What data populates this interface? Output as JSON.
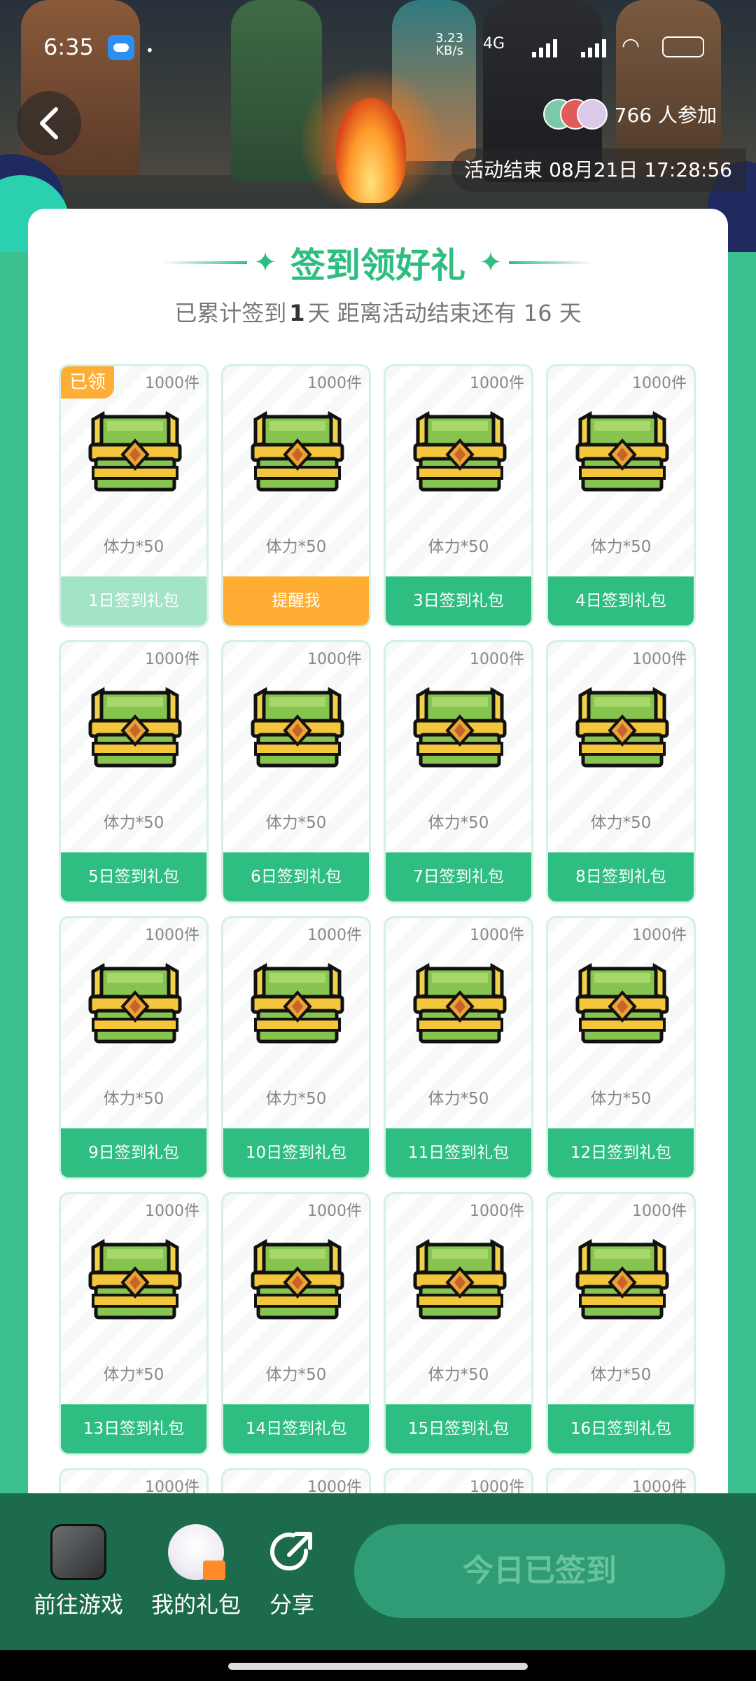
{
  "status_bar": {
    "time": "6:35",
    "rate": "3.23\nKB/s",
    "network": "4G"
  },
  "header": {
    "participants_text": "766 人参加",
    "end_time_label": "活动结束 08月21日 17:28:56"
  },
  "panel": {
    "title": "签到领好礼",
    "subtitle_prefix": "已累计签到",
    "subtitle_days": "1",
    "subtitle_middle": "天  距离活动结束还有 16 天"
  },
  "cards": [
    {
      "qty": "1000件",
      "reward": "体力*50",
      "button": "1日签到礼包",
      "state": "claimed",
      "badge": "已领"
    },
    {
      "qty": "1000件",
      "reward": "体力*50",
      "button": "提醒我",
      "state": "remind"
    },
    {
      "qty": "1000件",
      "reward": "体力*50",
      "button": "3日签到礼包",
      "state": "normal"
    },
    {
      "qty": "1000件",
      "reward": "体力*50",
      "button": "4日签到礼包",
      "state": "normal"
    },
    {
      "qty": "1000件",
      "reward": "体力*50",
      "button": "5日签到礼包",
      "state": "normal"
    },
    {
      "qty": "1000件",
      "reward": "体力*50",
      "button": "6日签到礼包",
      "state": "normal"
    },
    {
      "qty": "1000件",
      "reward": "体力*50",
      "button": "7日签到礼包",
      "state": "normal"
    },
    {
      "qty": "1000件",
      "reward": "体力*50",
      "button": "8日签到礼包",
      "state": "normal"
    },
    {
      "qty": "1000件",
      "reward": "体力*50",
      "button": "9日签到礼包",
      "state": "normal"
    },
    {
      "qty": "1000件",
      "reward": "体力*50",
      "button": "10日签到礼包",
      "state": "normal"
    },
    {
      "qty": "1000件",
      "reward": "体力*50",
      "button": "11日签到礼包",
      "state": "normal"
    },
    {
      "qty": "1000件",
      "reward": "体力*50",
      "button": "12日签到礼包",
      "state": "normal"
    },
    {
      "qty": "1000件",
      "reward": "体力*50",
      "button": "13日签到礼包",
      "state": "normal"
    },
    {
      "qty": "1000件",
      "reward": "体力*50",
      "button": "14日签到礼包",
      "state": "normal"
    },
    {
      "qty": "1000件",
      "reward": "体力*50",
      "button": "15日签到礼包",
      "state": "normal"
    },
    {
      "qty": "1000件",
      "reward": "体力*50",
      "button": "16日签到礼包",
      "state": "normal"
    },
    {
      "qty": "1000件",
      "reward": "",
      "button": "",
      "state": "partial"
    },
    {
      "qty": "1000件",
      "reward": "",
      "button": "",
      "state": "partial"
    },
    {
      "qty": "1000件",
      "reward": "",
      "button": "",
      "state": "partial"
    },
    {
      "qty": "1000件",
      "reward": "",
      "button": "",
      "state": "partial"
    }
  ],
  "bottom": {
    "go_game": "前往游戏",
    "my_gifts": "我的礼包",
    "share": "分享",
    "checkin_button": "今日已签到"
  },
  "colors": {
    "accent": "#2ebe82",
    "remind": "#ffad33",
    "claimed": "#a3e3c6",
    "bottom_bar": "#1d6b4d"
  }
}
